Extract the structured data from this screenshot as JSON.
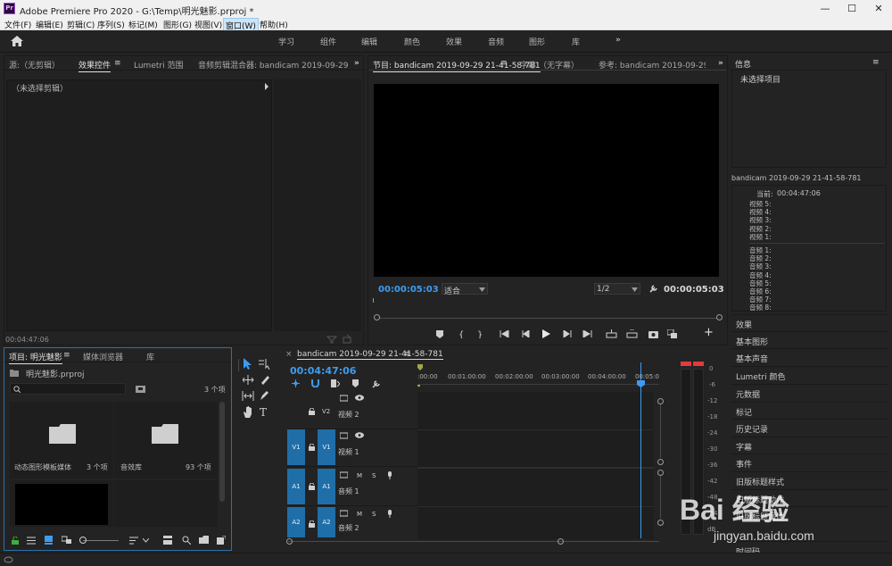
{
  "window": {
    "title": "Adobe Premiere Pro 2020 - G:\\Temp\\明光魅影.prproj *",
    "app_badge": "Pr",
    "controls": {
      "minimize": "—",
      "maximize": "☐",
      "close": "✕"
    }
  },
  "menu": [
    "文件(F)",
    "编辑(E)",
    "剪辑(C)",
    "序列(S)",
    "标记(M)",
    "图形(G)",
    "视图(V)",
    "窗口(W)",
    "帮助(H)"
  ],
  "menu_active_index": 7,
  "workspaces": [
    "学习",
    "组件",
    "编辑",
    "颜色",
    "效果",
    "音频",
    "图形",
    "库"
  ],
  "workspaces_more": "»",
  "source_panel": {
    "tabs": [
      "源:（无剪辑）",
      "效果控件",
      "Lumetri 范围",
      "音频剪辑混合器: bandicam 2019-09-29 21-41-5"
    ],
    "active_tab": 1,
    "menu_glyph": "≡",
    "more": "»",
    "clip_label": "（未选择剪辑）",
    "timecode": "00:04:47:06"
  },
  "program_panel": {
    "tabs": [
      "节目: bandicam 2019-09-29 21-41-58-781",
      "字幕:（无字幕）",
      "参考: bandicam 2019-09-29 21-41-5"
    ],
    "active_tab": 0,
    "menu_glyph": "≡",
    "more": "»",
    "current_time": "00:00:05:03",
    "fit": "适合",
    "resolution": "1/2",
    "duration": "00:00:05:03",
    "add_button": "+"
  },
  "info_panel": {
    "title": "信息",
    "menu_glyph": "≡",
    "no_selection": "未选择项目",
    "sequence_name": "bandicam 2019-09-29 21-41-58-781",
    "current_label": "当前:",
    "current_value": "00:04:47:06",
    "video_tracks": [
      "视频 5:",
      "视频 4:",
      "视频 3:",
      "视频 2:",
      "视频 1:"
    ],
    "audio_tracks": [
      "音频 1:",
      "音频 2:",
      "音频 3:",
      "音频 4:",
      "音频 5:",
      "音频 6:",
      "音频 7:",
      "音频 8:"
    ]
  },
  "right_panels": [
    "效果",
    "基本图形",
    "基本声音",
    "Lumetri 颜色",
    "元数据",
    "标记",
    "历史记录",
    "字幕",
    "事件",
    "旧版标题样式",
    "旧版标题动作",
    "旧版标题属性",
    "时间码"
  ],
  "project_panel": {
    "tabs": [
      "项目: 明光魅影",
      "媒体浏览器",
      "库"
    ],
    "active_tab": 0,
    "menu_glyph": "≡",
    "file_name": "明光魅影.prproj",
    "search_placeholder": "",
    "item_count": "3 个项",
    "bins": [
      {
        "name": "动态图形模板媒体",
        "count": "3 个项"
      },
      {
        "name": "音效库",
        "count": "93 个项"
      }
    ]
  },
  "tools": [
    "selection",
    "track-select",
    "ripple-edit",
    "razor",
    "slip",
    "pen",
    "hand",
    "type"
  ],
  "timeline": {
    "close_glyph": "×",
    "sequence_name": "bandicam 2019-09-29 21-41-58-781",
    "menu_glyph": "≡",
    "timecode": "00:04:47:06",
    "ruler": [
      ":00:00",
      "00:01:00:00",
      "00:02:00:00",
      "00:03:00:00",
      "00:04:00:00",
      "00:05:0"
    ],
    "tracks": [
      {
        "id": "V2",
        "name": "视频 2",
        "kind": "video",
        "target": "",
        "source": "V2"
      },
      {
        "id": "V1",
        "name": "视频 1",
        "kind": "video",
        "target": "V1",
        "source": "V1"
      },
      {
        "id": "A1",
        "name": "音频 1",
        "kind": "audio",
        "target": "A1",
        "source": "A1"
      },
      {
        "id": "A2",
        "name": "音频 2",
        "kind": "audio",
        "target": "A2",
        "source": "A2"
      }
    ],
    "mute_label": "M",
    "solo_label": "S"
  },
  "audio_meter": {
    "scale": [
      "0",
      "-6",
      "-12",
      "-18",
      "-24",
      "-30",
      "-36",
      "-42",
      "-48",
      "-54",
      "dB"
    ]
  },
  "watermark": {
    "brand": "Bai 经验",
    "url": "jingyan.baidu.com"
  },
  "colors": {
    "accent_blue": "#3d9cf2",
    "track_blue": "#1f6ea8",
    "meter_red": "#e23b3b",
    "playhead": "#3d9cf2"
  }
}
